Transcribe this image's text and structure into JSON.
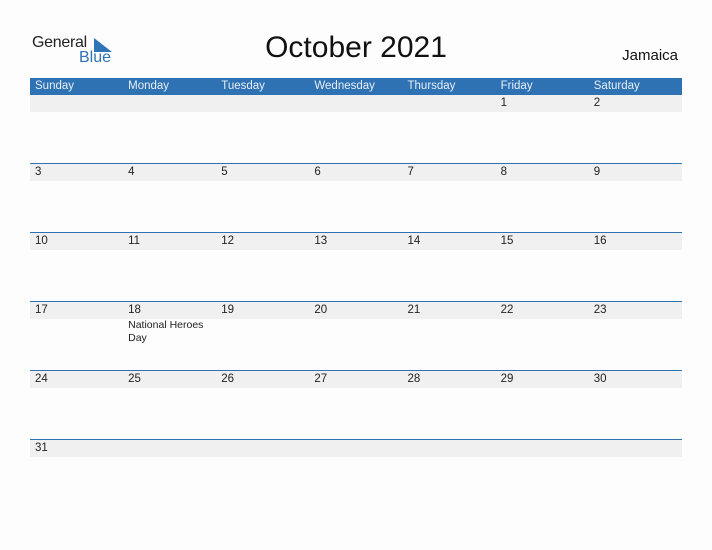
{
  "logo": {
    "general": "General",
    "blue": "Blue",
    "icon": "triangle-flag-icon"
  },
  "header": {
    "title": "October 2021",
    "country": "Jamaica"
  },
  "colors": {
    "accent": "#2e72b3",
    "date_row_bg": "#f0f0f0"
  },
  "weekdays": [
    "Sunday",
    "Monday",
    "Tuesday",
    "Wednesday",
    "Thursday",
    "Friday",
    "Saturday"
  ],
  "weeks": [
    {
      "days": [
        "",
        "",
        "",
        "",
        "",
        "1",
        "2"
      ],
      "holidays": [
        "",
        "",
        "",
        "",
        "",
        "",
        ""
      ]
    },
    {
      "days": [
        "3",
        "4",
        "5",
        "6",
        "7",
        "8",
        "9"
      ],
      "holidays": [
        "",
        "",
        "",
        "",
        "",
        "",
        ""
      ]
    },
    {
      "days": [
        "10",
        "11",
        "12",
        "13",
        "14",
        "15",
        "16"
      ],
      "holidays": [
        "",
        "",
        "",
        "",
        "",
        "",
        ""
      ]
    },
    {
      "days": [
        "17",
        "18",
        "19",
        "20",
        "21",
        "22",
        "23"
      ],
      "holidays": [
        "",
        "National Heroes Day",
        "",
        "",
        "",
        "",
        ""
      ]
    },
    {
      "days": [
        "24",
        "25",
        "26",
        "27",
        "28",
        "29",
        "30"
      ],
      "holidays": [
        "",
        "",
        "",
        "",
        "",
        "",
        ""
      ]
    },
    {
      "days": [
        "31",
        "",
        "",
        "",
        "",
        "",
        ""
      ],
      "holidays": [
        "",
        "",
        "",
        "",
        "",
        "",
        ""
      ]
    }
  ]
}
